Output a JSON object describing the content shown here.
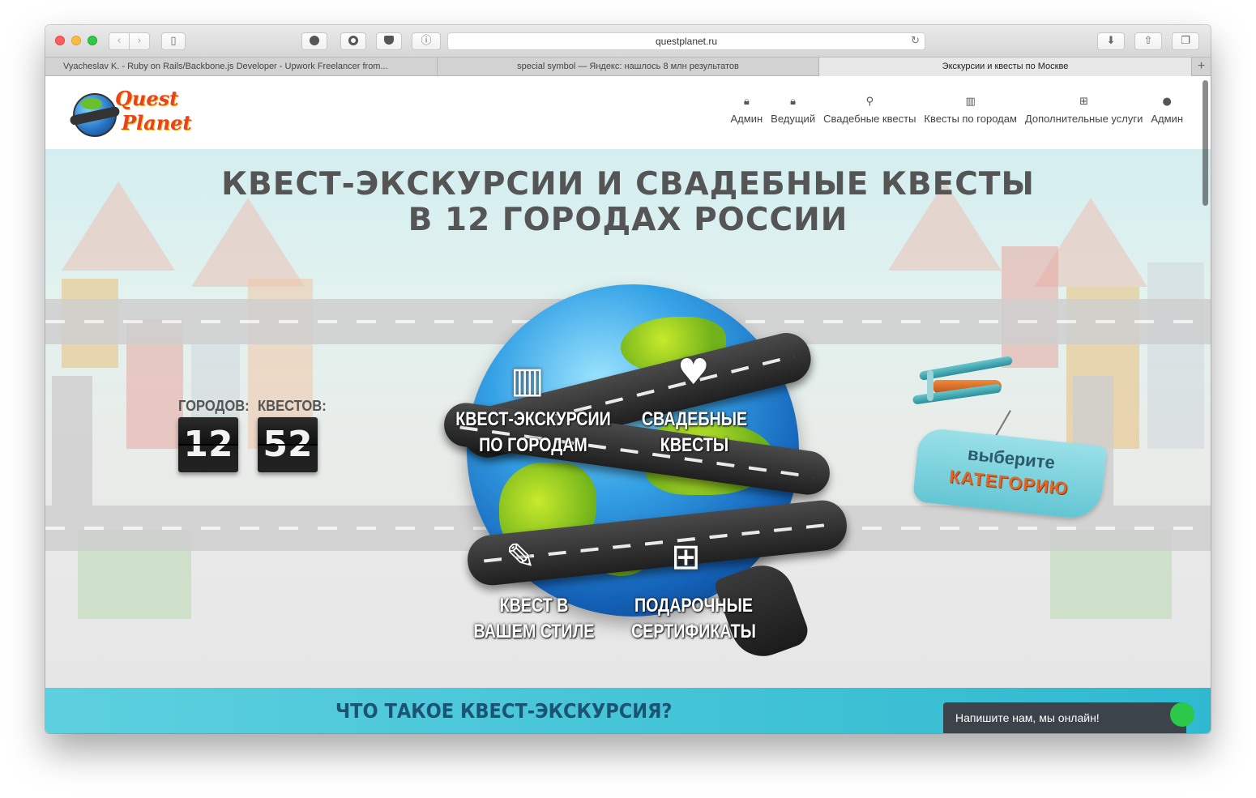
{
  "browser": {
    "url": "questplanet.ru",
    "tabs": [
      {
        "title": "Vyacheslav K. - Ruby on Rails/Backbone.js Developer - Upwork Freelancer from..."
      },
      {
        "title": "special symbol — Яндекс: нашлось 8 млн результатов"
      },
      {
        "title": "Экскурсии и квесты по Москве"
      }
    ],
    "icons": {
      "back": "chevron-left-icon",
      "forward": "chevron-right-icon",
      "sidebar": "sidebar-icon",
      "reload": "reload-icon",
      "download": "download-icon",
      "share": "share-icon",
      "tabs": "tabs-icon",
      "new_tab": "plus-icon"
    }
  },
  "site": {
    "logo": {
      "line1": "Quest",
      "line2": "Planet"
    },
    "nav": [
      {
        "label": "Админ",
        "icon": "lock-icon"
      },
      {
        "label": "Ведущий",
        "icon": "lock-icon"
      },
      {
        "label": "Свадебные квесты",
        "icon": "couple-icon"
      },
      {
        "label": "Квесты по городам",
        "icon": "city-icon"
      },
      {
        "label": "Дополнительные услуги",
        "icon": "gift-icon"
      },
      {
        "label": "Админ",
        "icon": "user-icon"
      }
    ],
    "hero": {
      "title_line1": "КВЕСТ-ЭКСКУРСИИ И СВАДЕБНЫЕ КВЕСТЫ",
      "title_line2": "В 12 ГОРОДАХ РОССИИ",
      "cities_label": "ГОРОДОВ:",
      "cities_value": "12",
      "quests_label": "КВЕСТОВ:",
      "quests_value": "52",
      "categories": [
        {
          "line1": "КВЕСТ-ЭКСКУРСИИ",
          "line2": "ПО ГОРОДАМ",
          "icon": "city-icon"
        },
        {
          "line1": "СВАДЕБНЫЕ",
          "line2": "КВЕСТЫ",
          "icon": "wedding-couple-icon"
        },
        {
          "line1": "КВЕСТ В",
          "line2": "ВАШЕМ СТИЛЕ",
          "icon": "palette-icon"
        },
        {
          "line1": "ПОДАРОЧНЫЕ",
          "line2": "СЕРТИФИКАТЫ",
          "icon": "gift-icon"
        }
      ],
      "banner_line1": "выберите",
      "banner_line2": "КАТЕГОРИЮ"
    },
    "section_title": "ЧТО ТАКОЕ КВЕСТ-ЭКСКУРСИЯ?",
    "chat": {
      "label": "Напишите нам, мы онлайн!"
    }
  },
  "colors": {
    "accent_orange": "#e8421e",
    "section_teal": "#3fc4d6",
    "title_gray": "#555555",
    "chat_bg": "#3d434a",
    "online_green": "#2cc84a"
  }
}
